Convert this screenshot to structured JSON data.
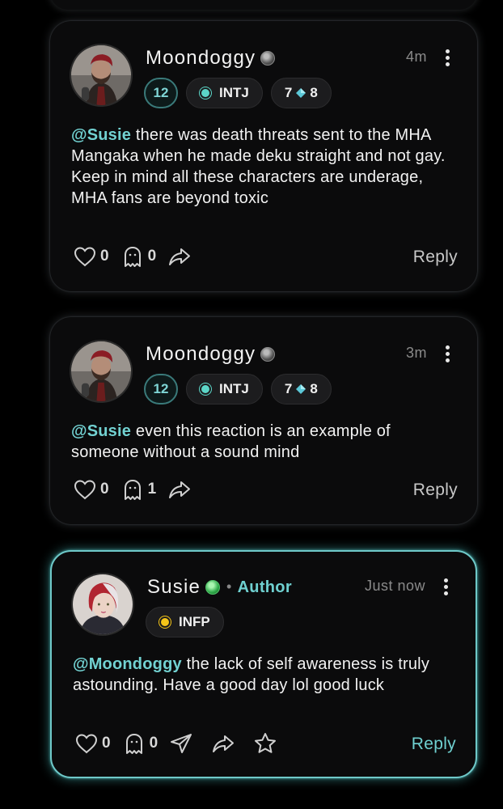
{
  "comments": [
    {
      "username": "Moondoggy",
      "status": "gray",
      "time": "4m",
      "level": "12",
      "mbti": "INTJ",
      "enneagram_left": "7",
      "enneagram_right": "8",
      "mention": "@Susie",
      "text": " there was death threats sent to the MHA Mangaka when he made deku straight and not gay. Keep in mind all these characters are underage, MHA fans are beyond toxic",
      "likes": "0",
      "ghosts": "0",
      "reply": "Reply"
    },
    {
      "username": "Moondoggy",
      "status": "gray",
      "time": "3m",
      "level": "12",
      "mbti": "INTJ",
      "enneagram_left": "7",
      "enneagram_right": "8",
      "mention": "@Susie",
      "text": " even this reaction is an example of someone without a sound mind",
      "likes": "0",
      "ghosts": "1",
      "reply": "Reply"
    },
    {
      "username": "Susie",
      "status": "green",
      "author_label": "Author",
      "time": "Just now",
      "mbti": "INFP",
      "mention": "@Moondoggy",
      "text": " the lack of self awareness is truly astounding. Have a good day lol good luck",
      "likes": "0",
      "ghosts": "0",
      "reply": "Reply"
    }
  ],
  "colors": {
    "accent": "#6fd0d0",
    "background": "#000000",
    "card": "#0b0b0c",
    "mbti_intj_dot": "#5cd6c8",
    "mbti_infp_dot": "#f5c518"
  },
  "icons": [
    "heart-icon",
    "ghost-icon",
    "share-icon",
    "send-icon",
    "star-icon",
    "more-vertical-icon"
  ]
}
